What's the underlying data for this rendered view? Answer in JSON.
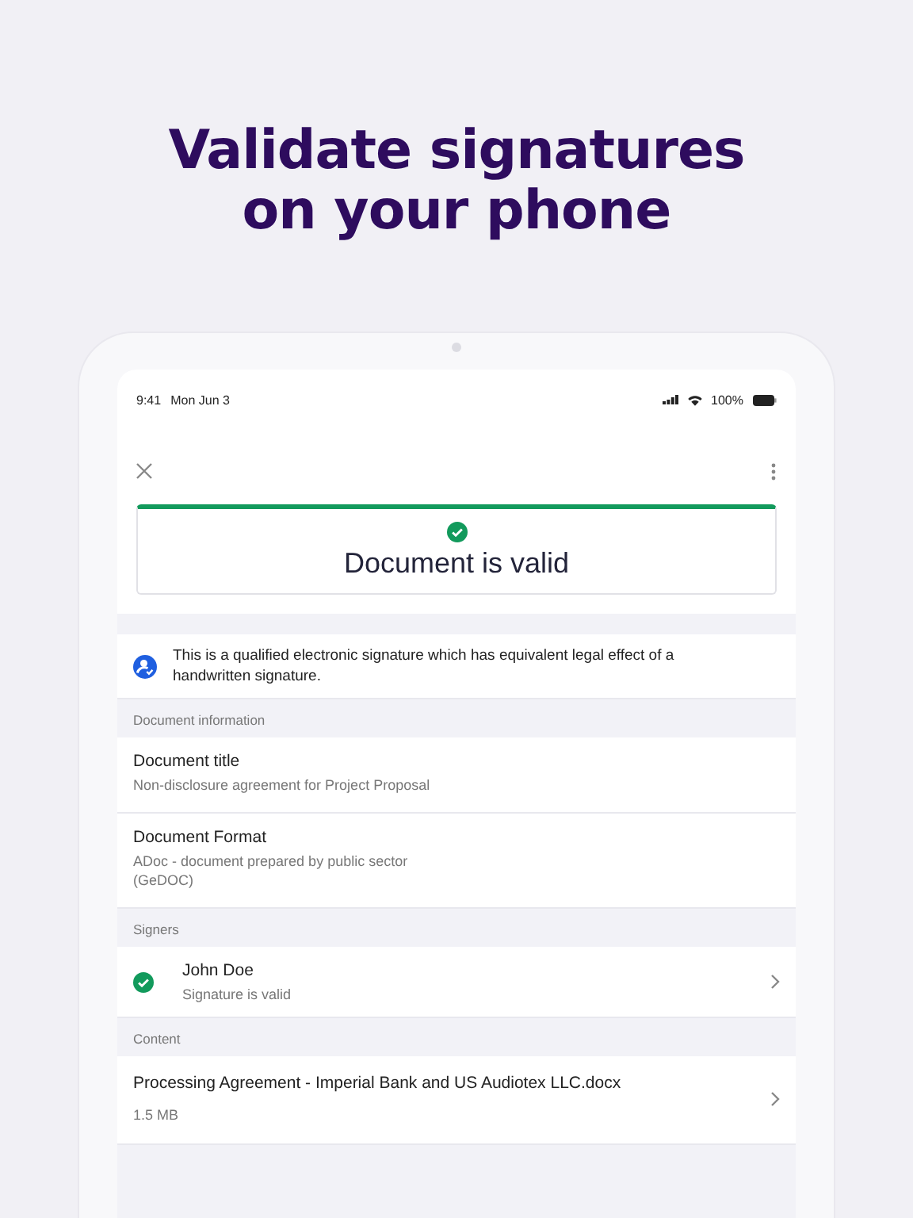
{
  "headline": [
    "Validate signatures",
    "on your phone"
  ],
  "status_bar": {
    "time": "9:41",
    "date": "Mon Jun 3",
    "battery": "100%"
  },
  "result": {
    "title": "Document is valid",
    "valid": true
  },
  "notice": "This is a qualified electronic signature which has equivalent legal effect of a handwritten signature.",
  "sections": [
    {
      "header": "Document information",
      "rows": [
        {
          "kind": "field",
          "label": "Document title",
          "value": "Non-disclosure agreement for Project Proposal"
        },
        {
          "kind": "field",
          "label": "Document Format",
          "value": "ADoc - document prepared by public sector\n(GeDOC)"
        }
      ]
    },
    {
      "header": "Signers",
      "rows": [
        {
          "kind": "signer",
          "label": "John Doe",
          "value": "Signature is valid",
          "valid": true
        }
      ]
    },
    {
      "header": "Content",
      "rows": [
        {
          "kind": "file",
          "label": "Processing Agreement - Imperial Bank and US Audiotex LLC.docx",
          "value": "1.5 MB"
        }
      ]
    }
  ]
}
